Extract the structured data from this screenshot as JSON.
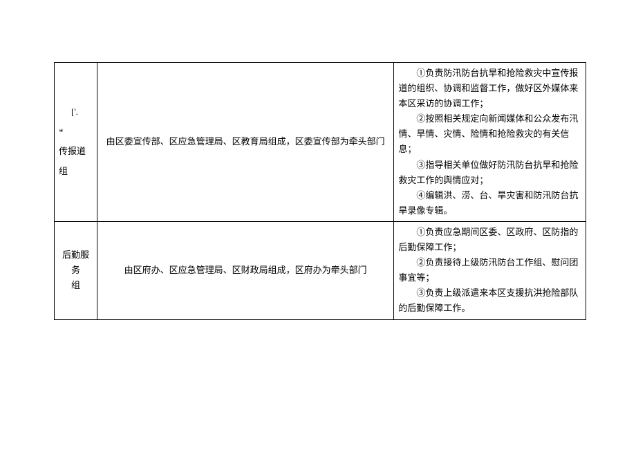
{
  "rows": [
    {
      "name_prefix": "['.",
      "name_star": "*",
      "name_body": "传报道组",
      "composition": "由区委宣传部、区应急管理局、区教育局组成，区委宣传部为牵头部门",
      "duty1": "①负责防汛防台抗旱和抢险救灾中宣传报道的组织、协调和监督工作，做好区外媒体来本区采访的协调工作；",
      "duty2": "②按照相关规定向新闻媒体和公众发布汛情、旱情、灾情、险情和抢险救灾的有关信息；",
      "duty3": "③指导相关单位做好防汛防台抗旱和抢险救灾工作的舆情应对；",
      "duty4": "④编辑洪、涝、台、旱灾害和防汛防台抗旱录像专辑。"
    },
    {
      "name_line1": "后勤服务",
      "name_line2": "组",
      "composition": "由区府办、区应急管理局、区财政局组成，区府办为牵头部门",
      "duty1": "①负责应急期间区委、区政府、区防指的后勤保障工作；",
      "duty2": "②负责接待上级防汛防台工作组、慰问团事宜等；",
      "duty3": "③负责上级派遣来本区支援抗洪抢险部队的后勤保障工作。"
    }
  ]
}
